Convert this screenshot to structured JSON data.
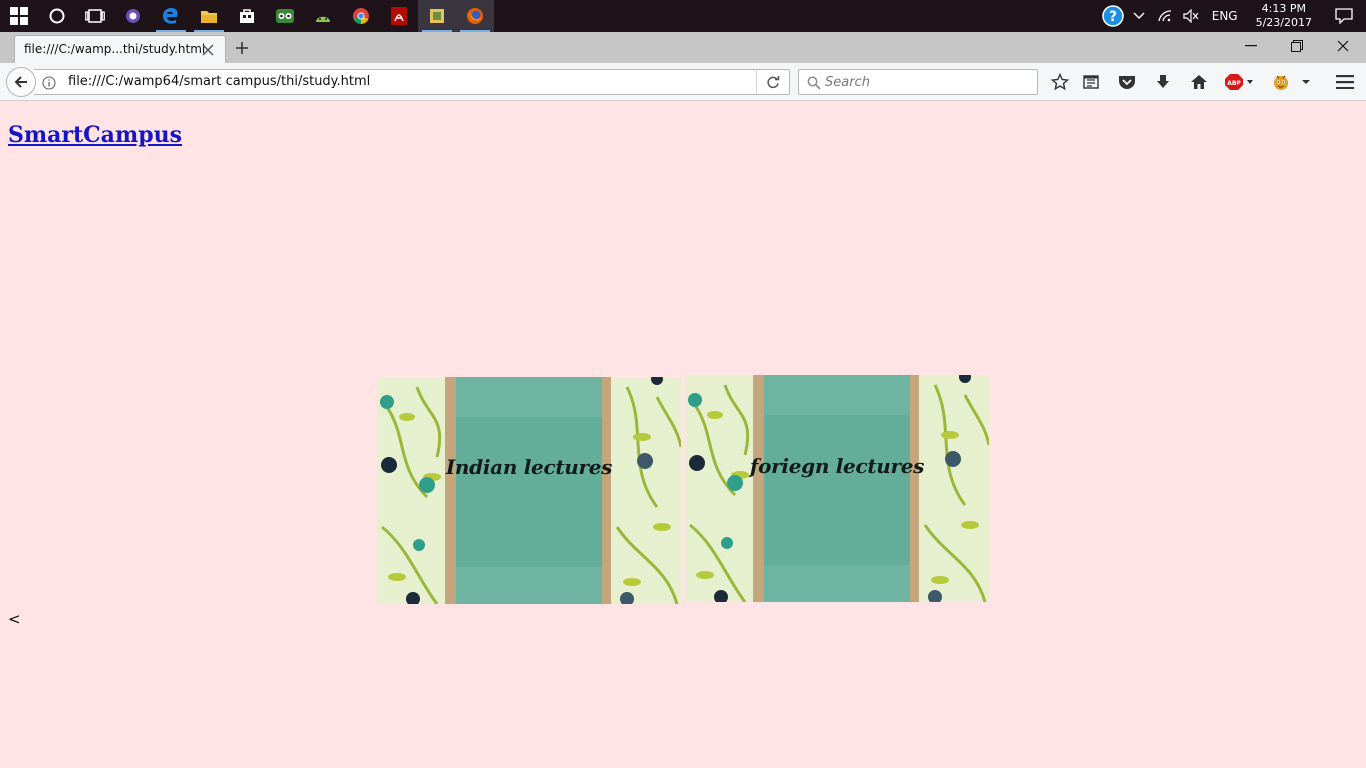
{
  "taskbar": {
    "icons": [
      "windows-start-icon",
      "cortana-icon",
      "task-view-icon",
      "app-icon",
      "edge-icon",
      "file-explorer-icon",
      "store-icon",
      "tripadvisor-icon",
      "android-icon",
      "chrome-icon",
      "acrobat-icon",
      "app-icon",
      "firefox-icon"
    ],
    "language": "ENG",
    "time": "4:13 PM",
    "date": "5/23/2017"
  },
  "browser": {
    "tab_title": "file:///C:/wamp...thi/study.html",
    "url": "file:///C:/wamp64/smart campus/thi/study.html",
    "search_placeholder": "Search"
  },
  "page": {
    "site_title": "SmartCampus",
    "cards": [
      {
        "label": "Indian lectures"
      },
      {
        "label": "foriegn lectures"
      }
    ],
    "stray_text": "<"
  },
  "colors": {
    "page_background": "#ffe3e5",
    "link": "#1414c8",
    "taskbar": "#1d1318"
  }
}
